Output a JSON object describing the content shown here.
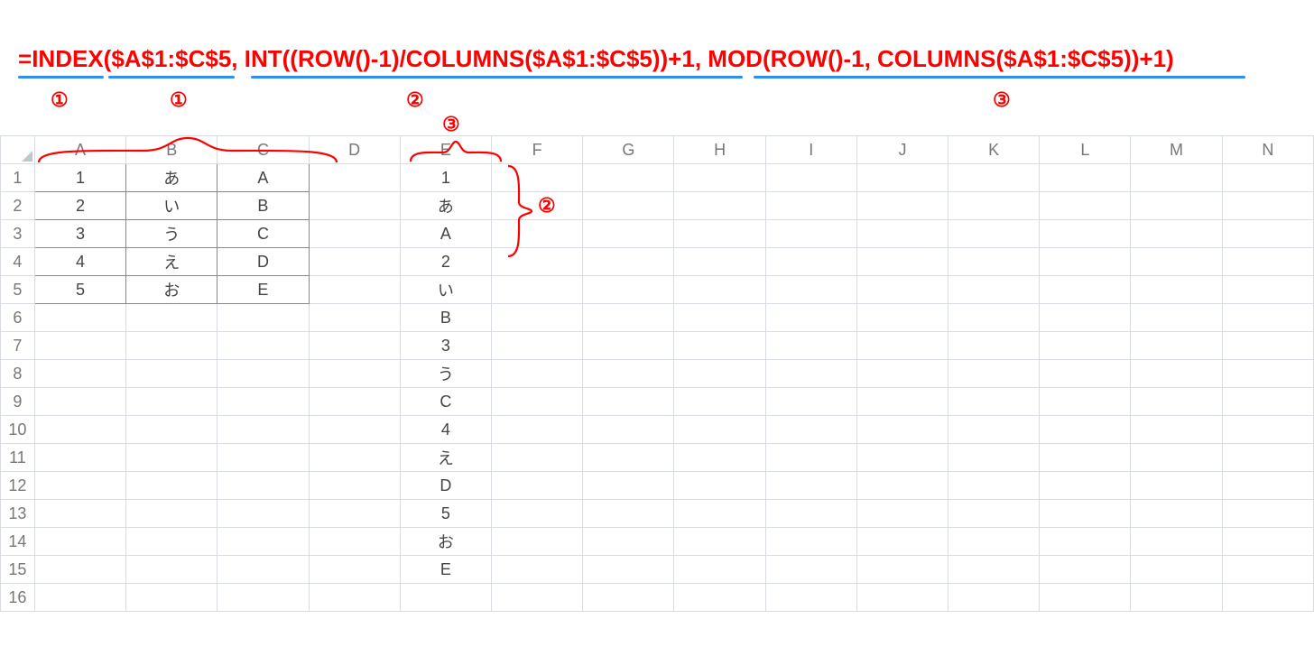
{
  "formula": {
    "part_eq": "=",
    "part_index_open": "INDEX(",
    "part_range1": "$A$1:$C$5",
    "part_sep1": ", ",
    "part_int": "INT((ROW()-1)/COLUMNS($A$1:$C$5))+1",
    "part_sep2": ", ",
    "part_mod": "MOD(ROW()-1, COLUMNS($A$1:$C$5))+1",
    "part_close": ")"
  },
  "labels": {
    "c1": "①",
    "c2": "②",
    "c3": "③"
  },
  "columns": [
    "A",
    "B",
    "C",
    "D",
    "E",
    "F",
    "G",
    "H",
    "I",
    "J",
    "K",
    "L",
    "M",
    "N"
  ],
  "row_numbers": [
    "1",
    "2",
    "3",
    "4",
    "5",
    "6",
    "7",
    "8",
    "9",
    "10",
    "11",
    "12",
    "13",
    "14",
    "15",
    "16"
  ],
  "table": {
    "A": [
      "1",
      "2",
      "3",
      "4",
      "5"
    ],
    "B": [
      "あ",
      "い",
      "う",
      "え",
      "お"
    ],
    "C": [
      "A",
      "B",
      "C",
      "D",
      "E"
    ]
  },
  "colE": [
    "1",
    "あ",
    "A",
    "2",
    "い",
    "B",
    "3",
    "う",
    "C",
    "4",
    "え",
    "D",
    "5",
    "お",
    "E"
  ]
}
